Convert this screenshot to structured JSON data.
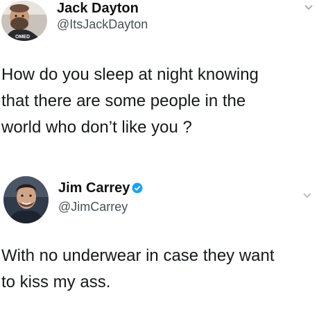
{
  "tweets": [
    {
      "name": "Jack Dayton",
      "handle": "@ItsJackDayton",
      "verified": false,
      "avatar_icon": "profile-photo-man-with-beard",
      "text_lines": [
        "How do you sleep at night knowing",
        "that there are some people in the",
        "world who don’t like you ?"
      ],
      "menu_icon": "chevron-down-icon"
    },
    {
      "name": "Jim Carrey",
      "handle": "@JimCarrey",
      "verified": true,
      "verified_icon": "verified-badge-icon",
      "avatar_icon": "profile-photo-smiling-man",
      "text_lines": [
        "With no underwear in case they want",
        "to kiss my ass."
      ],
      "menu_icon": "chevron-down-icon"
    }
  ],
  "colors": {
    "verified_blue": "#1da1f2",
    "handle_gray": "#4a4f55",
    "text": "#16181b"
  }
}
